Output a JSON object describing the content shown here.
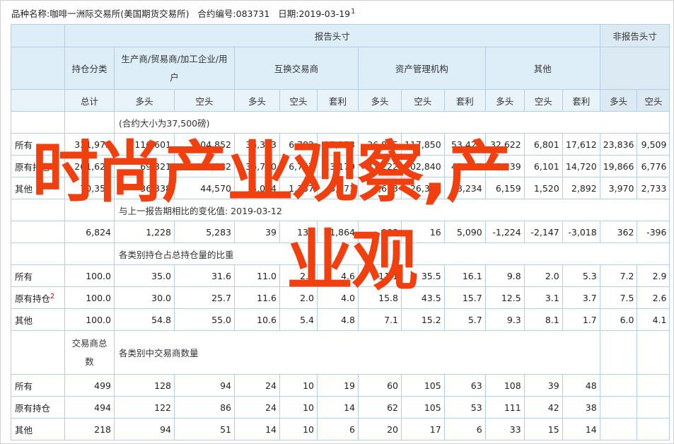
{
  "topline": {
    "name_label": "品种名称:",
    "name_value": "咖啡一洲际交易所(美国期货交易所)",
    "code_label": "合约编号:",
    "code_value": "083731",
    "date_label": "日期:",
    "date_value": "2019-03-19",
    "note": "1"
  },
  "headers": {
    "report": "报告头寸",
    "nonreport": "非报告头寸",
    "category": "持仓分类",
    "producer": "生产商/贸易商/加工企业/用户",
    "swap": "互换交易商",
    "managed": "资产管理机构",
    "other": "其他",
    "total": "总计",
    "long": "多头",
    "short": "空头",
    "spread": "套利"
  },
  "sections": {
    "holdings": "(合约大小为37,500磅)",
    "change": "与上一报告期相比的变化值: 2019-03-12",
    "share": "各类别持仓占总持仓量的比重",
    "traders_head": "交易商总数",
    "traders": "各类别中交易商数量"
  },
  "rows": {
    "holdings": [
      {
        "label": "所有",
        "sup": "",
        "values": [
          "331,973",
          "116,601",
          "104,852",
          "36,373",
          "6,782",
          "15,153",
          "36,895",
          "117,850",
          "53,421",
          "32,622",
          "6,801",
          "17,612",
          "23,836",
          "9,509"
        ]
      },
      {
        "label": "原有持仓",
        "sup": "",
        "values": [
          "261,620",
          "69,321",
          "60,282",
          "36,700",
          "6,757",
          "13,179",
          "41,222",
          "102,840",
          "45,187",
          "33,239",
          "6,101",
          "14,720",
          "19,866",
          "6,776"
        ]
      },
      {
        "label": "其他",
        "sup": "",
        "values": [
          "70,353",
          "36,338",
          "44,570",
          "5,034",
          "1,357",
          "3,171",
          "4,673",
          "26,318",
          "8,234",
          "6,159",
          "1,520",
          "2,892",
          "3,970",
          "2,733"
        ]
      }
    ],
    "change": [
      "6,824",
      "1,228",
      "5,283",
      "39",
      "132",
      "1,864",
      "908",
      "16",
      "5,090",
      "-1,224",
      "-2,147",
      "-3,018",
      "362",
      "-396"
    ],
    "share": [
      {
        "label": "所有",
        "sup": "",
        "values": [
          "100.0",
          "35.0",
          "31.6",
          "11.0",
          "2.0",
          "4.6",
          "11.1",
          "35.5",
          "16.1",
          "9.8",
          "2.0",
          "5.3",
          "7.2",
          "2.9"
        ]
      },
      {
        "label": "原有持仓",
        "sup": "2",
        "values": [
          "100.0",
          "30.0",
          "25.7",
          "11.6",
          "2.0",
          "4.0",
          "15.8",
          "43.5",
          "15.7",
          "12.5",
          "3.1",
          "3.7",
          "7.5",
          "2.6"
        ]
      },
      {
        "label": "其他",
        "sup": "",
        "values": [
          "100.0",
          "54.8",
          "55.0",
          "10.6",
          "5.4",
          "4.8",
          "7.1",
          "15.2",
          "5.7",
          "9.3",
          "8.1",
          "1.7",
          "6.0",
          "4.1"
        ]
      }
    ],
    "traders": [
      {
        "label": "所有",
        "sup": "",
        "values": [
          "499",
          "128",
          "94",
          "24",
          "10",
          "19",
          "60",
          "105",
          "63",
          "108",
          "39",
          "48",
          "",
          ""
        ]
      },
      {
        "label": "原有持仓",
        "sup": "",
        "values": [
          "494",
          "122",
          "86",
          "24",
          "10",
          "14",
          "62",
          "105",
          "53",
          "111",
          "42",
          "38",
          "",
          ""
        ]
      },
      {
        "label": "其他",
        "sup": "",
        "values": [
          "218",
          "94",
          "51",
          "14",
          "10",
          "6",
          "20",
          "17",
          "6",
          "33",
          "15",
          "14",
          "",
          ""
        ]
      }
    ]
  },
  "watermark": {
    "line1": "时尚产业观察,产",
    "line2": "业观"
  }
}
